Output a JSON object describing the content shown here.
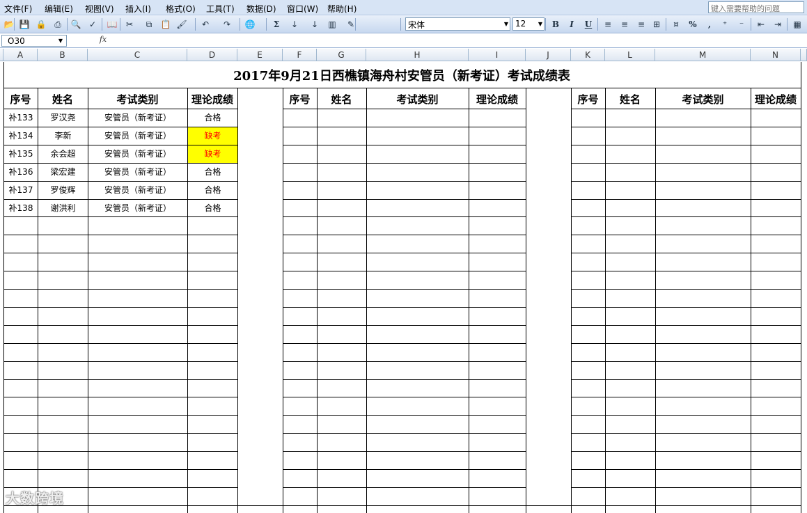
{
  "menu": {
    "items": [
      "文件(F)",
      "编辑(E)",
      "视图(V)",
      "插入(I)",
      "格式(O)",
      "工具(T)",
      "数据(D)",
      "窗口(W)",
      "帮助(H)"
    ],
    "help_placeholder": "键入需要帮助的问题"
  },
  "toolbar": {
    "font": "宋体",
    "size": "12",
    "icons": [
      "open-icon",
      "save-icon",
      "permission-icon",
      "print-icon",
      "print-preview-icon",
      "spelling-icon",
      "research-icon",
      "cut-icon",
      "copy-icon",
      "paste-icon",
      "format-painter-icon",
      "undo-icon",
      "redo-icon",
      "hyperlink-icon",
      "autosum-icon",
      "sort-ascending-icon",
      "sort-descending-icon",
      "chart-wizard-icon",
      "drawing-icon",
      "bold-icon",
      "italic-icon",
      "underline-icon",
      "align-left-icon",
      "center-icon",
      "align-right-icon",
      "merge-center-icon",
      "currency-icon",
      "percent-icon",
      "comma-icon",
      "increase-decimal-icon",
      "decrease-decimal-icon",
      "decrease-indent-icon",
      "increase-indent-icon",
      "borders-icon"
    ],
    "bold": "B",
    "italic": "I",
    "underline": "U",
    "sum": "Σ",
    "percent": "%",
    "comma": ","
  },
  "formula": {
    "name_box": "O30",
    "fx_label": "fx",
    "content": ""
  },
  "columns": [
    "A",
    "B",
    "C",
    "D",
    "E",
    "F",
    "G",
    "H",
    "I",
    "J",
    "K",
    "L",
    "M",
    "N"
  ],
  "sheet": {
    "title": "2017年9月21日西樵镇海舟村安管员（新考证）考试成绩表",
    "headers": [
      "序号",
      "姓名",
      "考试类别",
      "理论成绩"
    ],
    "rows": [
      {
        "id": "补133",
        "name": "罗汉尧",
        "category": "安管员（新考证）",
        "score": "合格",
        "absent": false
      },
      {
        "id": "补134",
        "name": "李新",
        "category": "安管员（新考证）",
        "score": "缺考",
        "absent": true
      },
      {
        "id": "补135",
        "name": "余会超",
        "category": "安管员（新考证）",
        "score": "缺考",
        "absent": true
      },
      {
        "id": "补136",
        "name": "梁宏建",
        "category": "安管员（新考证）",
        "score": "合格",
        "absent": false
      },
      {
        "id": "补137",
        "name": "罗俊辉",
        "category": "安管员（新考证）",
        "score": "合格",
        "absent": false
      },
      {
        "id": "补138",
        "name": "谢洪利",
        "category": "安管员（新考证）",
        "score": "合格",
        "absent": false
      }
    ],
    "absent_bg": "#ffff00",
    "absent_color": "#ff0000"
  },
  "watermark": "大数跨境"
}
